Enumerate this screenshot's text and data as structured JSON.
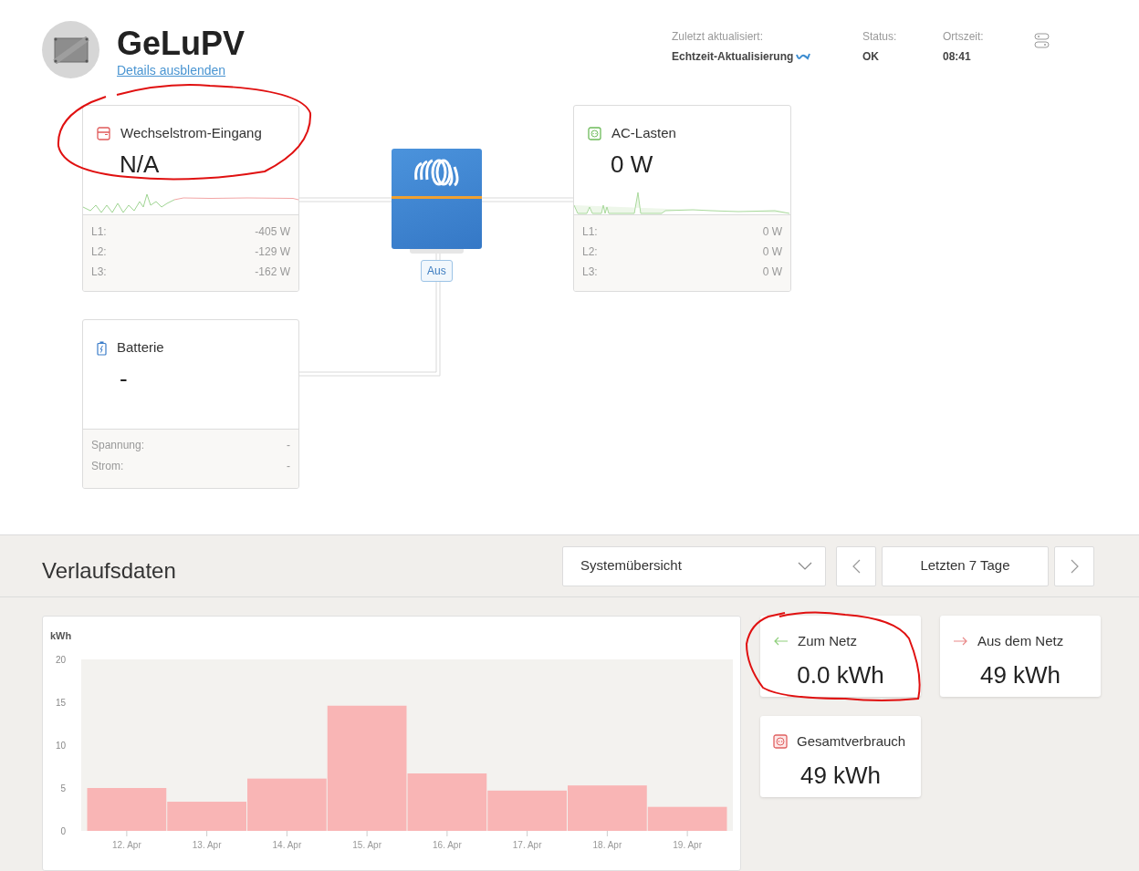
{
  "site": {
    "title": "GeLuPV",
    "details_link": "Details ausblenden"
  },
  "info": [
    {
      "label": "Zuletzt aktualisiert:",
      "value": "Echtzeit-Aktualisierung",
      "live": true
    },
    {
      "label": "Status:",
      "value": "OK",
      "live": false
    },
    {
      "label": "Ortszeit:",
      "value": "08:41",
      "live": false
    }
  ],
  "ac_input": {
    "title": "Wechselstrom-Eingang",
    "value": "N/A",
    "rows": [
      {
        "label": "L1:",
        "value": "-405 W"
      },
      {
        "label": "L2:",
        "value": "-129 W"
      },
      {
        "label": "L3:",
        "value": "-162 W"
      }
    ]
  },
  "inverter": {
    "state": "Aus"
  },
  "ac_loads": {
    "title": "AC-Lasten",
    "value": "0 W",
    "rows": [
      {
        "label": "L1:",
        "value": "0 W"
      },
      {
        "label": "L2:",
        "value": "0 W"
      },
      {
        "label": "L3:",
        "value": "0 W"
      }
    ]
  },
  "battery": {
    "title": "Batterie",
    "value": "-",
    "rows": [
      {
        "label": "Spannung:",
        "value": "-"
      },
      {
        "label": "Strom:",
        "value": "-"
      }
    ]
  },
  "history": {
    "title": "Verlaufsdaten",
    "view_select": "Systemübersicht",
    "range": "Letzten 7 Tage",
    "chart_data": {
      "type": "bar",
      "ylabel": "kWh",
      "categories": [
        "12. Apr",
        "13. Apr",
        "14. Apr",
        "15. Apr",
        "16. Apr",
        "17. Apr",
        "18. Apr",
        "19. Apr"
      ],
      "series": [
        {
          "color": "#f9b5b5",
          "values": [
            5.0,
            3.4,
            6.1,
            14.6,
            6.7,
            4.7,
            5.3,
            2.8
          ]
        }
      ],
      "ylim": [
        0,
        20
      ],
      "yticks": [
        0,
        5,
        10,
        15,
        20
      ]
    },
    "stats": [
      {
        "kind": "to-grid",
        "label": "Zum Netz",
        "value": "0.0 kWh"
      },
      {
        "kind": "from-grid",
        "label": "Aus dem Netz",
        "value": "49 kWh"
      },
      {
        "kind": "consumption",
        "label": "Gesamtverbrauch",
        "value": "49 kWh"
      }
    ]
  }
}
